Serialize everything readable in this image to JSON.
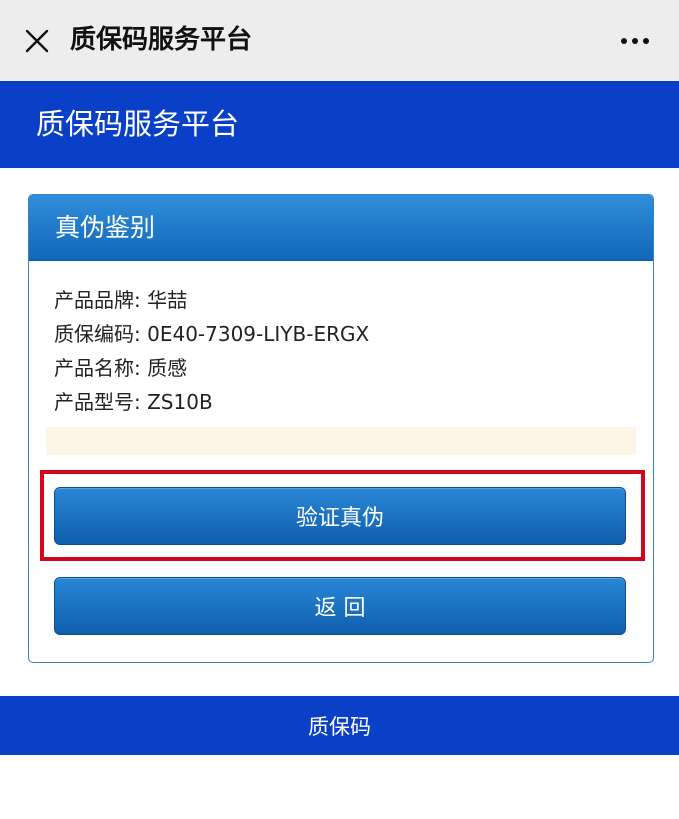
{
  "topbar": {
    "title": "质保码服务平台",
    "close_icon": "close-icon",
    "more_icon": "more-icon"
  },
  "header": {
    "title": "质保码服务平台"
  },
  "panel": {
    "title": "真伪鉴别",
    "info": [
      {
        "label": "产品品牌",
        "value": "华喆"
      },
      {
        "label": "质保编码",
        "value": "0E40-7309-LIYB-ERGX"
      },
      {
        "label": "产品名称",
        "value": "质感"
      },
      {
        "label": "产品型号",
        "value": "ZS10B"
      }
    ]
  },
  "buttons": {
    "verify_label": "验证真伪",
    "back_label": "返 回"
  },
  "footer": {
    "text": "质保码"
  },
  "colors": {
    "header_blue": "#0a3fc8",
    "button_blue": "#1a72c4",
    "highlight_red": "#d3071b",
    "notice_bg": "#fcf6e6"
  }
}
